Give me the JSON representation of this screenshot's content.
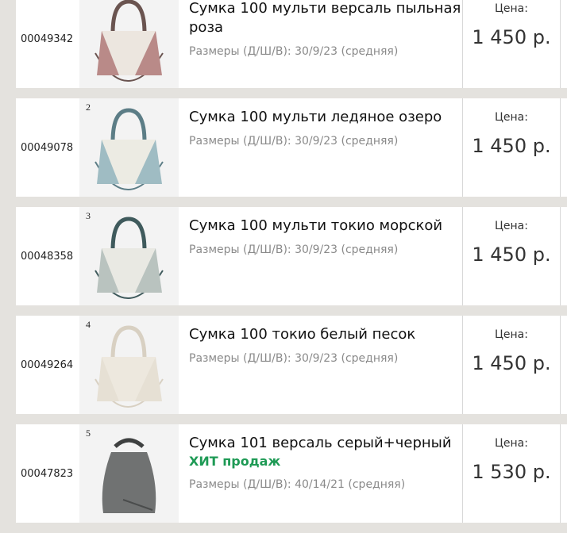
{
  "products": [
    {
      "code": "00049342",
      "index": "",
      "title": "Сумка 100 мульти версаль пыльная роза",
      "hit": "",
      "size": "Размеры (Д/Ш/В): 30/9/23 (средняя)",
      "price_label": "Цена:",
      "price": "1 450 р.",
      "colors": {
        "body": "#b98a88",
        "panel": "#ece6df",
        "handle": "#6a5450"
      }
    },
    {
      "code": "00049078",
      "index": "2",
      "title": "Сумка 100 мульти ледяное озеро",
      "hit": "",
      "size": "Размеры (Д/Ш/В): 30/9/23 (средняя)",
      "price_label": "Цена:",
      "price": "1 450 р.",
      "colors": {
        "body": "#9fbcc3",
        "panel": "#ecebe3",
        "handle": "#5c7d86"
      }
    },
    {
      "code": "00048358",
      "index": "3",
      "title": "Сумка 100 мульти токио морской",
      "hit": "",
      "size": "Размеры (Д/Ш/В): 30/9/23 (средняя)",
      "price_label": "Цена:",
      "price": "1 450 р.",
      "colors": {
        "body": "#b9c3bf",
        "panel": "#e9e9e3",
        "handle": "#3f5a5c"
      }
    },
    {
      "code": "00049264",
      "index": "4",
      "title": "Сумка 100 токио белый песок",
      "hit": "",
      "size": "Размеры (Д/Ш/В): 30/9/23 (средняя)",
      "price_label": "Цена:",
      "price": "1 450 р.",
      "colors": {
        "body": "#e6e0d4",
        "panel": "#ede8de",
        "handle": "#d8d0c2"
      }
    },
    {
      "code": "00047823",
      "index": "5",
      "title": "Сумка 101 версаль серый+черный",
      "hit": "ХИТ продаж",
      "size": "Размеры (Д/Ш/В): 40/14/21 (средняя)",
      "price_label": "Цена:",
      "price": "1 530 р.",
      "colors": {
        "body": "#707272",
        "panel": "#7b7d7d",
        "handle": "#3e4040"
      }
    }
  ]
}
